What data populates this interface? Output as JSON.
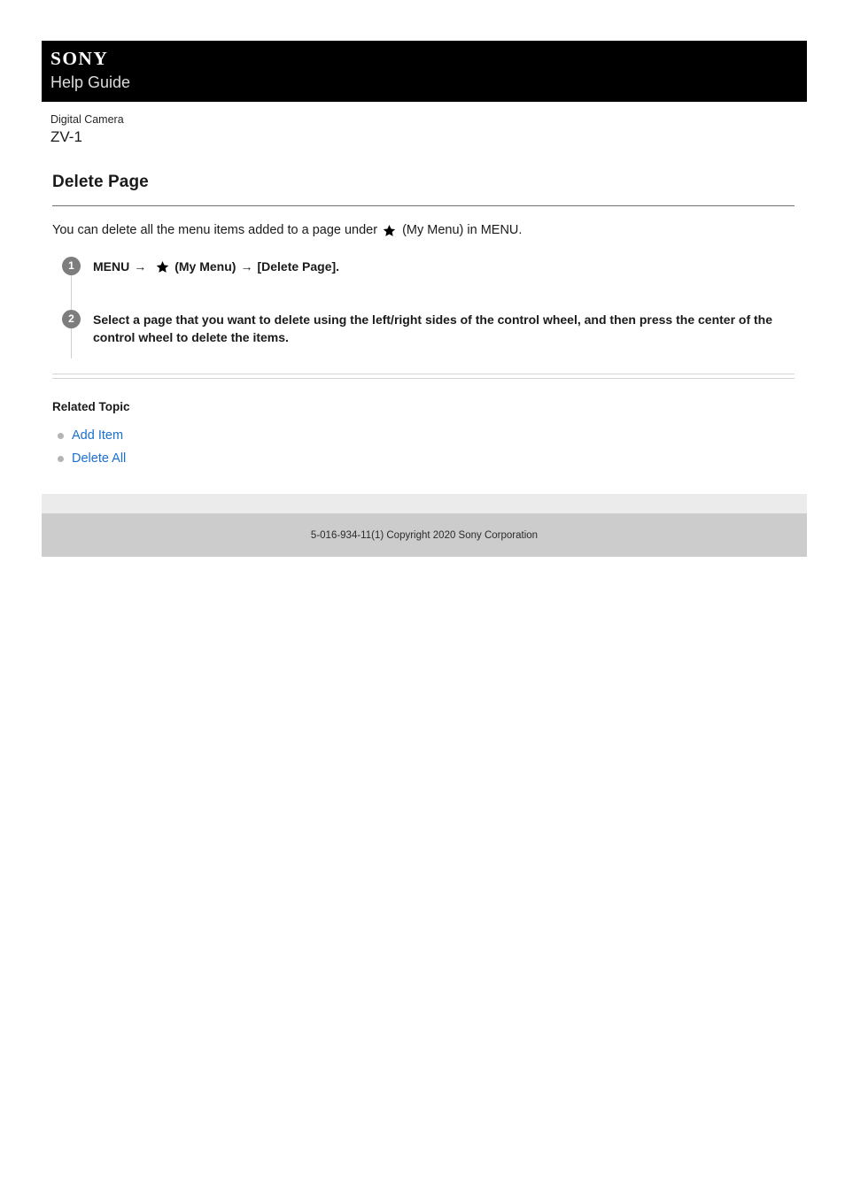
{
  "header": {
    "brand": "SONY",
    "site_title": "Help Guide"
  },
  "product": {
    "category": "Digital Camera",
    "model": "ZV-1"
  },
  "article": {
    "title": "Delete Page",
    "intro": {
      "before_icon": "You can delete all the menu items added to a page under",
      "icon": "star-icon",
      "after_icon": "(My Menu) in MENU."
    },
    "steps": [
      {
        "number": "1",
        "parts": {
          "menu": "MENU",
          "arrow1": "→",
          "icon": "star-icon",
          "my_menu": "(My Menu)",
          "arrow2": "→",
          "target": "[Delete Page]."
        }
      },
      {
        "number": "2",
        "text": "Select a page that you want to delete using the left/right sides of the control wheel, and then press the center of the control wheel to delete the items."
      }
    ]
  },
  "related": {
    "heading": "Related Topic",
    "links": [
      {
        "label": "Add Item"
      },
      {
        "label": "Delete All"
      }
    ]
  },
  "footer": {
    "copyright": "5-016-934-11(1) Copyright 2020 Sony Corporation"
  },
  "colors": {
    "header_bg": "#000000",
    "link": "#1a6fd0",
    "step_marker": "#7d7d7d",
    "footer_top": "#ebebeb",
    "footer_bottom": "#cccccc"
  }
}
